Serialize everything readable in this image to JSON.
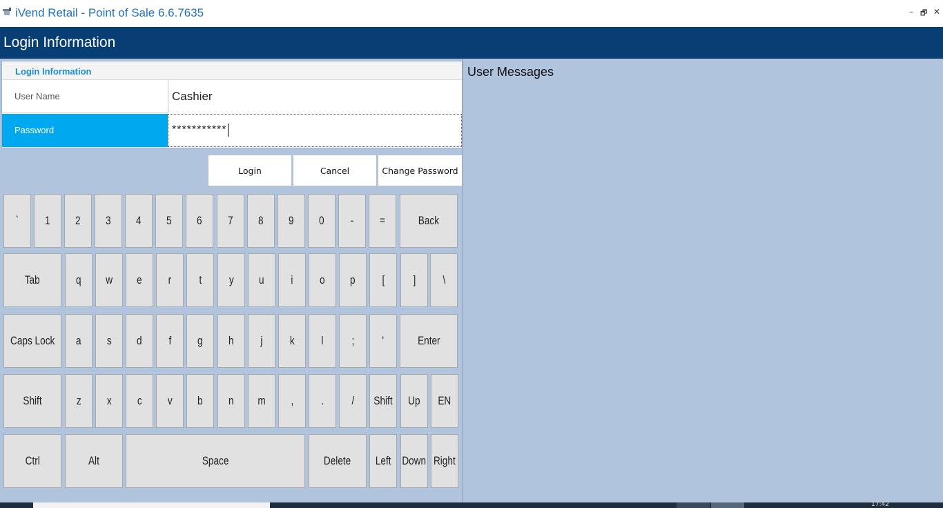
{
  "window": {
    "title": "iVend Retail - Point of Sale 6.6.7635",
    "minimize": "–",
    "restore": "🗗",
    "close": "✕"
  },
  "header": {
    "title": "Login Information"
  },
  "login": {
    "section_title": "Login Information",
    "username_label": "User Name",
    "username_value": "Cashier",
    "password_label": "Password",
    "password_value": "***********"
  },
  "actions": {
    "login": "Login",
    "cancel": "Cancel",
    "change_password": "Change Password"
  },
  "keyboard": {
    "row1": [
      "`",
      "1",
      "2",
      "3",
      "4",
      "5",
      "6",
      "7",
      "8",
      "9",
      "0",
      "-",
      "=",
      "Back"
    ],
    "row2": [
      "Tab",
      "q",
      "w",
      "e",
      "r",
      "t",
      "y",
      "u",
      "i",
      "o",
      "p",
      "[",
      "]",
      "\\"
    ],
    "row3": [
      "Caps Lock",
      "a",
      "s",
      "d",
      "f",
      "g",
      "h",
      "j",
      "k",
      "l",
      ";",
      "'",
      "Enter"
    ],
    "row4": [
      "Shift",
      "z",
      "x",
      "c",
      "v",
      "b",
      "n",
      "m",
      ",",
      ".",
      "/",
      "Shift",
      "Up",
      "EN"
    ],
    "row5": [
      "Ctrl",
      "Alt",
      "Space",
      "Delete",
      "Left",
      "Down",
      "Right"
    ]
  },
  "messages": {
    "title": "User Messages"
  },
  "taskbar": {
    "time": "17:42"
  },
  "colors": {
    "header_bg": "#073e73",
    "panel_bg": "#b0c4de",
    "selected_label_bg": "#00a8f0",
    "title_text": "#1e73be",
    "key_bg": "#e1e1e1"
  }
}
